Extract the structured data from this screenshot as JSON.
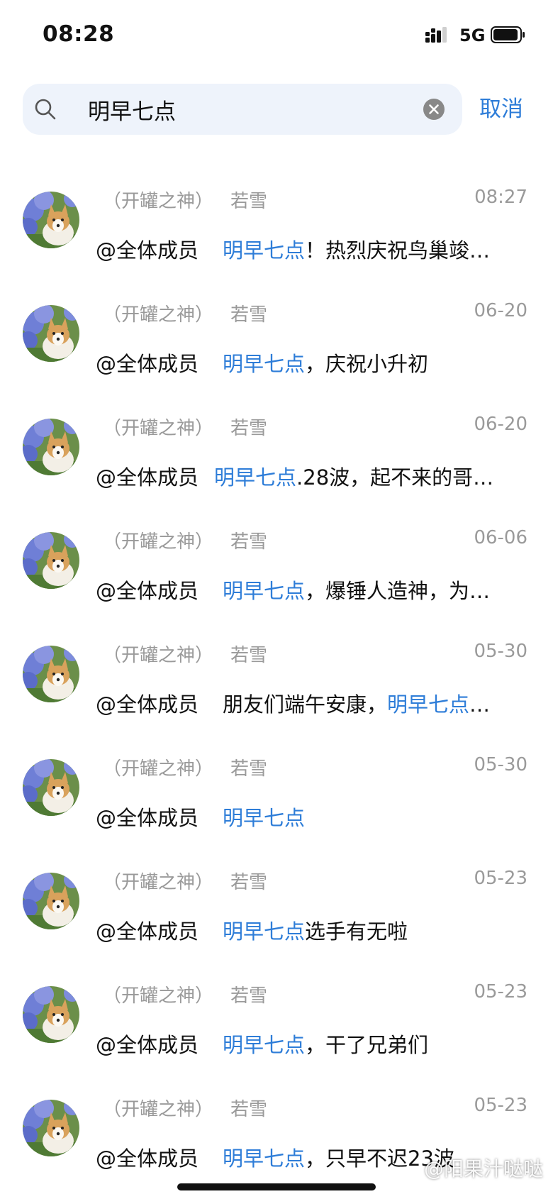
{
  "status_bar": {
    "time": "08:28",
    "network": "5G"
  },
  "search": {
    "query": "明早七点",
    "cancel_label": "取消"
  },
  "results": [
    {
      "group": "（开罐之神）",
      "name": "若雪",
      "time": "08:27",
      "mention": "@全体成员",
      "before": "",
      "highlight": "明早七点",
      "after": "！热烈庆祝鸟巢竣…"
    },
    {
      "group": "（开罐之神）",
      "name": "若雪",
      "time": "06-20",
      "mention": "@全体成员",
      "before": "",
      "highlight": "明早七点",
      "after": "，庆祝小升初"
    },
    {
      "group": "（开罐之神）",
      "name": "若雪",
      "time": "06-20",
      "mention": "@全体成员",
      "before": "",
      "highlight": "明早七点",
      "after": ".28波，起不来的哥…"
    },
    {
      "group": "（开罐之神）",
      "name": "若雪",
      "time": "06-06",
      "mention": "@全体成员",
      "before": "",
      "highlight": "明早七点",
      "after": "，爆锤人造神，为…"
    },
    {
      "group": "（开罐之神）",
      "name": "若雪",
      "time": "05-30",
      "mention": "@全体成员",
      "before": "朋友们端午安康，",
      "highlight": "明早七点",
      "after": "…"
    },
    {
      "group": "（开罐之神）",
      "name": "若雪",
      "time": "05-30",
      "mention": "@全体成员",
      "before": "",
      "highlight": "明早七点",
      "after": ""
    },
    {
      "group": "（开罐之神）",
      "name": "若雪",
      "time": "05-23",
      "mention": "@全体成员",
      "before": "",
      "highlight": "明早七点",
      "after": "选手有无啦"
    },
    {
      "group": "（开罐之神）",
      "name": "若雪",
      "time": "05-23",
      "mention": "@全体成员",
      "before": "",
      "highlight": "明早七点",
      "after": "，干了兄弟们"
    },
    {
      "group": "（开罐之神）",
      "name": "若雪",
      "time": "05-23",
      "mention": "@全体成员",
      "before": "",
      "highlight": "明早七点",
      "after": "，只早不迟23波"
    }
  ],
  "watermark": "@阳果汁哒哒",
  "icons": {
    "signal": "signal-icon",
    "battery": "battery-icon",
    "search": "search-icon",
    "clear": "clear-icon",
    "avatar": "corgi-hydrangea-avatar"
  },
  "colors": {
    "accent": "#2e7dd8",
    "muted": "#9a9a9a",
    "search_bg": "#eef3fb"
  }
}
